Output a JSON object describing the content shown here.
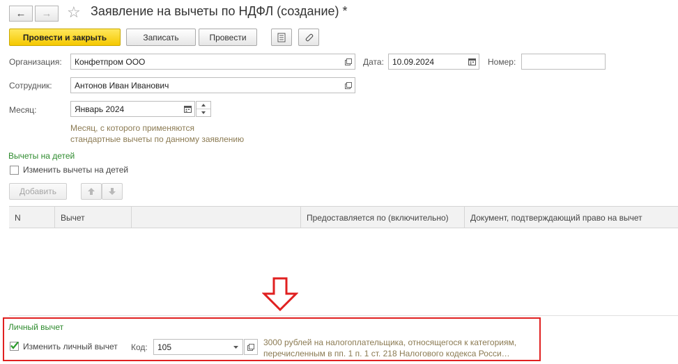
{
  "window": {
    "title": "Заявление на вычеты по НДФЛ (создание) *",
    "back_glyph": "←",
    "forward_glyph": "→",
    "favorite_glyph": "☆"
  },
  "toolbar": {
    "post_close_label": "Провести и закрыть",
    "save_label": "Записать",
    "post_label": "Провести"
  },
  "form": {
    "organization_label": "Организация:",
    "organization_value": "Конфетпром ООО",
    "date_label": "Дата:",
    "date_value": "10.09.2024",
    "number_label": "Номер:",
    "number_value": "",
    "employee_label": "Сотрудник:",
    "employee_value": "Антонов Иван Иванович",
    "month_label": "Месяц:",
    "month_value": "Январь 2024",
    "month_hint_line1": "Месяц, с которого применяются",
    "month_hint_line2": "стандартные вычеты по данному заявлению"
  },
  "children": {
    "section_title": "Вычеты на детей",
    "change_label": "Изменить вычеты на детей",
    "change_checked": false,
    "add_label": "Добавить",
    "columns": [
      "N",
      "Вычет",
      "",
      "Предоставляется по (включительно)",
      "Документ, подтверждающий право на вычет"
    ],
    "rows": []
  },
  "personal": {
    "section_title": "Личный вычет",
    "change_label": "Изменить личный вычет",
    "change_checked": true,
    "code_label": "Код:",
    "code_value": "105",
    "description_line1": "3000 рублей на налогоплательщика, относящегося к категориям,",
    "description_line2": "перечисленным в пп. 1 п. 1 ст. 218 Налогового кодекса Росси…"
  },
  "colors": {
    "accent_yellow": "#f5c800",
    "section_green": "#2e8b2e",
    "hint_brown": "#8b7a52",
    "highlight_red": "#e02020",
    "check_green": "#2a9a2a"
  }
}
